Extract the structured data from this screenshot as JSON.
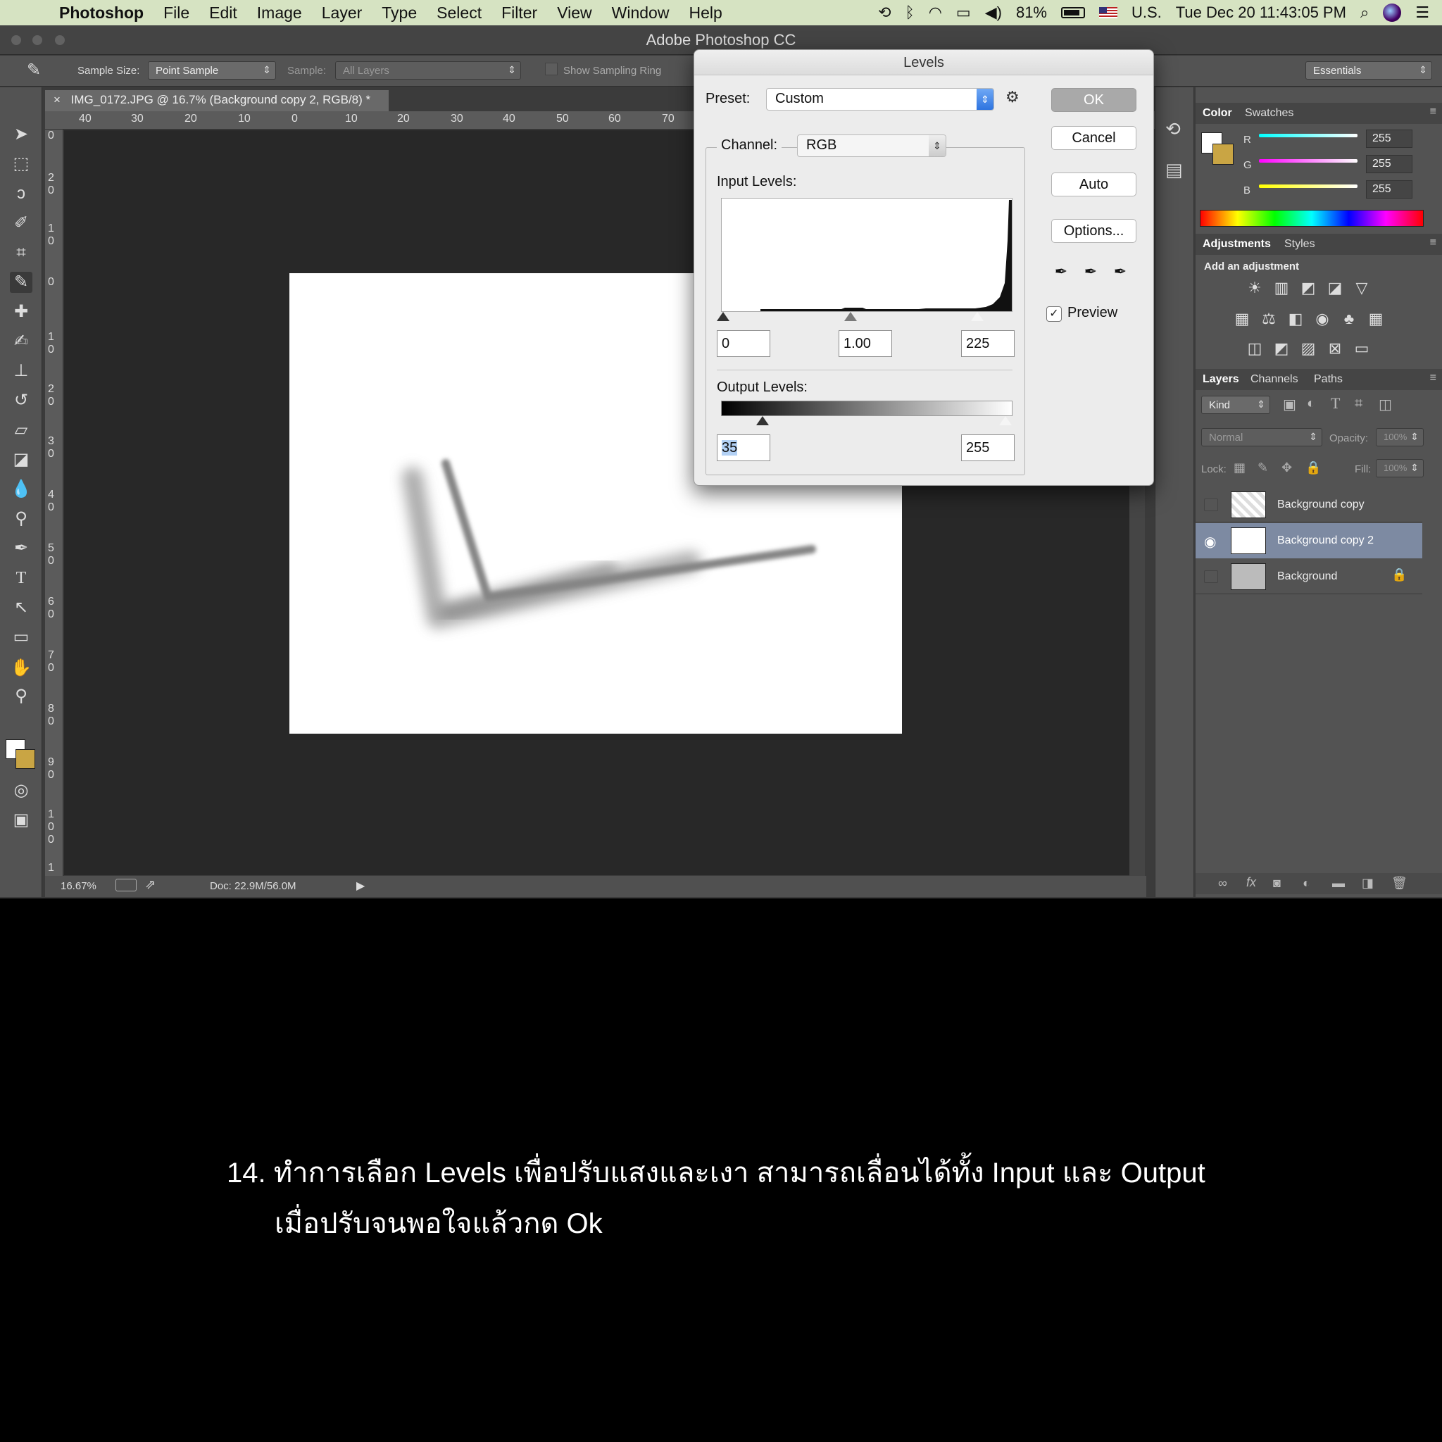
{
  "menubar": {
    "app_name": "Photoshop",
    "items": [
      "File",
      "Edit",
      "Image",
      "Layer",
      "Type",
      "Select",
      "Filter",
      "View",
      "Window",
      "Help"
    ],
    "battery": "81%",
    "input_source": "U.S.",
    "clock": "Tue Dec 20  11:43:05 PM"
  },
  "window": {
    "title": "Adobe Photoshop CC"
  },
  "options_bar": {
    "sample_size_label": "Sample Size:",
    "sample_size_value": "Point Sample",
    "sample_label": "Sample:",
    "sample_value": "All Layers",
    "sampling_ring_label": "Show Sampling Ring",
    "workspace": "Essentials"
  },
  "document": {
    "tab_title": "IMG_0172.JPG @ 16.7% (Background copy 2, RGB/8) *",
    "zoom": "16.67%",
    "doc_size": "Doc: 22.9M/56.0M",
    "ruler_h": [
      "40",
      "30",
      "20",
      "10",
      "0",
      "10",
      "20",
      "30",
      "40",
      "50",
      "60",
      "70"
    ],
    "ruler_v": [
      "0",
      "2 0",
      "1 0",
      "0",
      "1 0",
      "2 0",
      "3 0",
      "4 0",
      "5 0",
      "6 0",
      "7 0",
      "8 0",
      "9 0",
      "1 0 0",
      "1"
    ]
  },
  "color_panel": {
    "tabs": [
      "Color",
      "Swatches"
    ],
    "r_label": "R",
    "g_label": "G",
    "b_label": "B",
    "r": "255",
    "g": "255",
    "b": "255"
  },
  "adjustments_panel": {
    "tabs": [
      "Adjustments",
      "Styles"
    ],
    "heading": "Add an adjustment"
  },
  "layers_panel": {
    "tabs": [
      "Layers",
      "Channels",
      "Paths"
    ],
    "filter": "Kind",
    "blend_mode": "Normal",
    "opacity_label": "Opacity:",
    "opacity": "100%",
    "lock_label": "Lock:",
    "fill_label": "Fill:",
    "fill": "100%",
    "layers": [
      {
        "name": "Background copy",
        "visible": false,
        "selected": false
      },
      {
        "name": "Background copy 2",
        "visible": true,
        "selected": true
      },
      {
        "name": "Background",
        "visible": false,
        "selected": false,
        "locked": true
      }
    ]
  },
  "levels_dialog": {
    "title": "Levels",
    "preset_label": "Preset:",
    "preset_value": "Custom",
    "channel_label": "Channel:",
    "channel_value": "RGB",
    "input_label": "Input Levels:",
    "input_black": "0",
    "input_gamma": "1.00",
    "input_white": "225",
    "output_label": "Output Levels:",
    "output_black": "35",
    "output_white": "255",
    "buttons": {
      "ok": "OK",
      "cancel": "Cancel",
      "auto": "Auto",
      "options": "Options..."
    },
    "preview_label": "Preview",
    "preview_checked": true
  },
  "caption": {
    "line1": "14. ทำการเลือก Levels เพื่อปรับแสงและเงา สามารถเลื่อนได้ทั้ง Input และ Output",
    "line2": "เมื่อปรับจนพอใจแล้วกด Ok"
  },
  "colors": {
    "menubar_bg": "#d6e3c2",
    "panel_bg": "#535353",
    "canvas_bg": "#282828",
    "selected_layer": "#7d8aa2",
    "dialog_bg": "#ececec"
  }
}
